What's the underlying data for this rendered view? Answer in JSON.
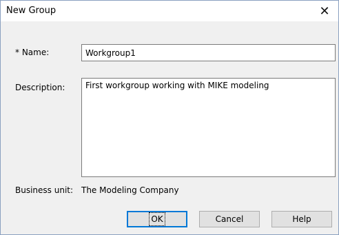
{
  "dialog": {
    "title": "New Group",
    "close_icon": "close-icon"
  },
  "form": {
    "name_label": "* Name:",
    "name_value": "Workgroup1",
    "description_label": "Description:",
    "description_value": "First workgroup working with MIKE modeling",
    "business_unit_label": "Business unit:",
    "business_unit_value": "The Modeling Company"
  },
  "buttons": {
    "ok_label": "OK",
    "cancel_label": "Cancel",
    "help_label": "Help"
  }
}
